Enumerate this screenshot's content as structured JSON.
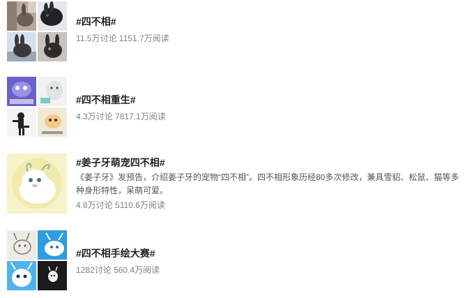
{
  "topics": [
    {
      "title": "#四不相#",
      "meta": "11.5万讨论 1151.7万阅读",
      "images": [
        "rabbit-photo-1",
        "rabbit-photo-2",
        "rabbit-photo-3",
        "rabbit-photo-4"
      ]
    },
    {
      "title": "#四不相重生#",
      "meta": "4.3万讨论 7817.1万阅读",
      "images": [
        "meme-image-1",
        "meme-image-2",
        "meme-image-3",
        "meme-image-4"
      ]
    },
    {
      "title": "#姜子牙萌宠四不相#",
      "description": "《姜子牙》发预告，介绍姜子牙的宠物“四不相”。四不相形象历经80多次修改，兼具雪貂、松鼠、猫等多种身形特性，呆萌可爱。",
      "meta": "4.8万讨论 5110.6万阅读",
      "images": [
        "sibuxiang-character-art"
      ]
    },
    {
      "title": "#四不相手绘大赛#",
      "meta": "1282讨论 560.4万阅读",
      "images": [
        "sketch-drawing",
        "blue-goat-art-1",
        "blue-goat-art-2",
        "dark-sketch-art"
      ]
    }
  ]
}
